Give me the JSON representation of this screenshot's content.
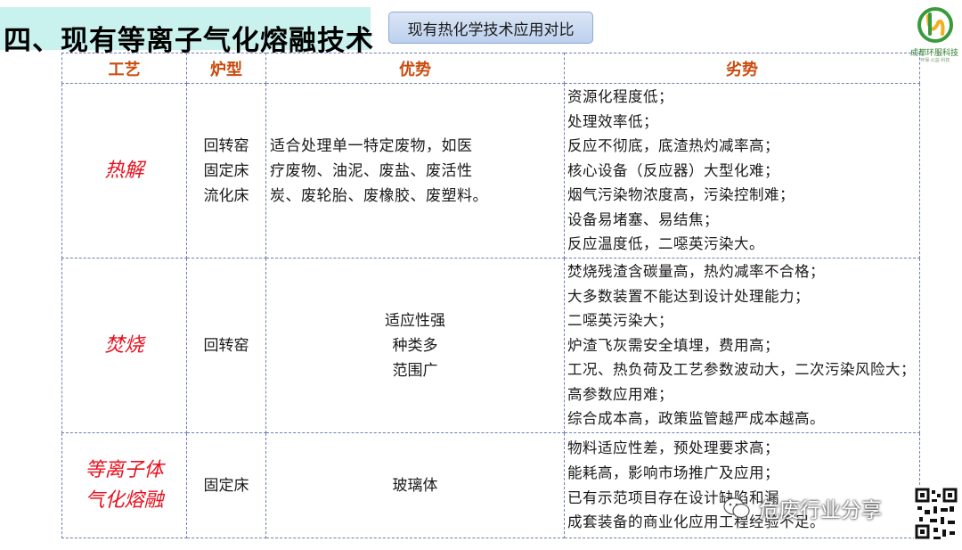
{
  "header": {
    "title": "四、现有等离子气化熔融技术",
    "tag_button": "现有热化学技术应用对比"
  },
  "logo": {
    "name": "成都环服科技",
    "sub": "·环保·公益·科技"
  },
  "table": {
    "columns": [
      "工艺",
      "炉型",
      "优势",
      "劣势"
    ],
    "rows": [
      {
        "process": [
          "热解"
        ],
        "furnaces": [
          "回转窑",
          "固定床",
          "流化床"
        ],
        "advantages": [
          "适合处理单一特定废物，如医",
          "疗废物、油泥、废盐、废活性",
          "炭、废轮胎、废橡胶、废塑料。"
        ],
        "disadvantages": [
          "资源化程度低；",
          "处理效率低；",
          "反应不彻底，底渣热灼减率高；",
          "核心设备（反应器）大型化难；",
          "烟气污染物浓度高，污染控制难；",
          "设备易堵塞、易结焦；",
          "反应温度低，二噁英污染大。"
        ]
      },
      {
        "process": [
          "焚烧"
        ],
        "furnaces": [
          "回转窑"
        ],
        "advantages": [
          "适应性强",
          "种类多",
          "范围广"
        ],
        "disadvantages": [
          "焚烧残渣含碳量高，热灼减率不合格；",
          "大多数装置不能达到设计处理能力；",
          "二噁英污染大；",
          "炉渣飞灰需安全填埋，费用高；",
          "工况、热负荷及工艺参数波动大，二次污染风险大；",
          "高参数应用难；",
          "综合成本高，政策监管越严成本越高。"
        ]
      },
      {
        "process": [
          "等离子体",
          "气化熔融"
        ],
        "furnaces": [
          "固定床"
        ],
        "advantages": [
          "玻璃体"
        ],
        "disadvantages": [
          "物料适应性差，预处理要求高；",
          "能耗高，影响市场推广及应用；",
          "已有示范项目存在设计缺陷和漏",
          "成套装备的商业化应用工程经验不足。"
        ]
      }
    ]
  },
  "watermark": {
    "text": "危废行业分享"
  }
}
